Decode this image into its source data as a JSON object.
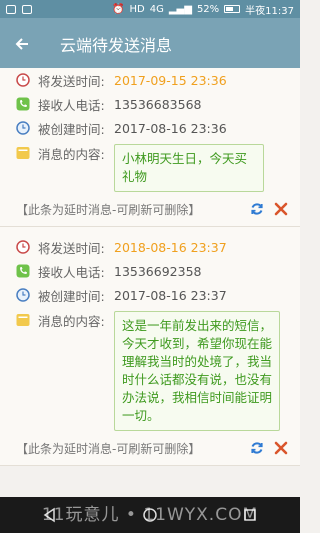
{
  "status_bar": {
    "battery": "52%",
    "time": "半夜11:37",
    "hd": "HD",
    "network": "4G"
  },
  "app_bar": {
    "back_icon": "arrow-left-icon",
    "title": "云端待发送消息"
  },
  "labels": {
    "send_time": "将发送时间:",
    "phone": "接收人电话:",
    "created": "被创建时间:",
    "content": "消息的内容:"
  },
  "messages": [
    {
      "send_time": "2017-09-15 23:36",
      "phone": "13536683568",
      "created": "2017-08-16 23:36",
      "content": "小林明天生日，今天买礼物",
      "note": "【此条为延时消息-可刷新可删除】"
    },
    {
      "send_time": "2018-08-16 23:37",
      "phone": "13536692358",
      "created": "2017-08-16 23:37",
      "content": "这是一年前发出来的短信，今天才收到，希望你现在能理解我当时的处境了，我当时什么话都没有说，也没有办法说，我相信时间能证明一切。",
      "note": "【此条为延时消息-可刷新可删除】"
    }
  ],
  "watermark": "11玩意儿 • 11WYX.COM",
  "colors": {
    "app_bar": "#7aa3b5",
    "send_time": "#f0a01e",
    "bubble_text": "#3f9a1f",
    "bubble_border": "#b9d89a"
  }
}
